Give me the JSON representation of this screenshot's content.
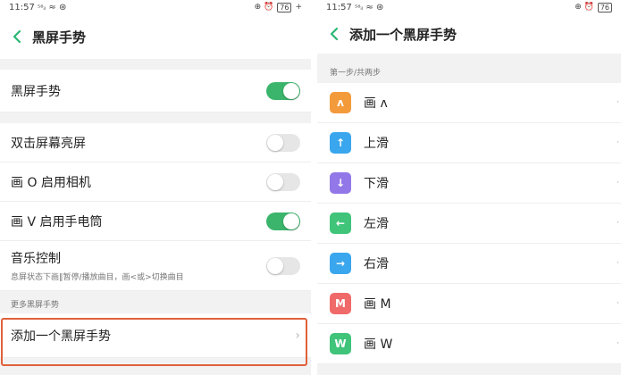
{
  "left": {
    "status": {
      "time": "11:57",
      "signal": "⁵⁶ᵢₗ",
      "wifi": "≈",
      "extra": "⊛",
      "icons": "⊕ ⏰",
      "battery": "76",
      "plus": "+"
    },
    "title": "黑屏手势",
    "rows": {
      "main_toggle": {
        "label": "黑屏手势",
        "on": true
      },
      "double_tap": {
        "label": "双击屏幕亮屏",
        "on": false
      },
      "draw_o": {
        "label": "画 O 启用相机",
        "on": false
      },
      "draw_v": {
        "label": "画 V 启用手电筒",
        "on": true
      },
      "music": {
        "label": "音乐控制",
        "sub": "息屏状态下画‖暂停/播放曲目，画<或>切换曲目",
        "on": false
      }
    },
    "more_caption": "更多黑屏手势",
    "add_gesture": {
      "label": "添加一个黑屏手势",
      "chevron": "›"
    }
  },
  "right": {
    "status": {
      "time": "11:57",
      "signal": "⁵⁶ᵢₗ",
      "wifi": "≈",
      "extra": "⊛",
      "icons": "⊕ ⏰",
      "battery": "76"
    },
    "title": "添加一个黑屏手势",
    "step_caption": "第一步/共两步",
    "gestures": [
      {
        "label": "画 ʌ",
        "glyph": "ʌ",
        "color": "#f39a3b"
      },
      {
        "label": "上滑",
        "glyph": "↑",
        "color": "#3aa6ee"
      },
      {
        "label": "下滑",
        "glyph": "↓",
        "color": "#9277e8"
      },
      {
        "label": "左滑",
        "glyph": "←",
        "color": "#3fc47a"
      },
      {
        "label": "右滑",
        "glyph": "→",
        "color": "#3aa6ee"
      },
      {
        "label": "画 M",
        "glyph": "M",
        "color": "#f06a6a"
      },
      {
        "label": "画 W",
        "glyph": "W",
        "color": "#3fc47a"
      }
    ],
    "row_mark": "·"
  },
  "colors": {
    "toggle_on": "#3bb56b",
    "highlight": "#e0603a",
    "back_arrow": "#2bb673"
  }
}
